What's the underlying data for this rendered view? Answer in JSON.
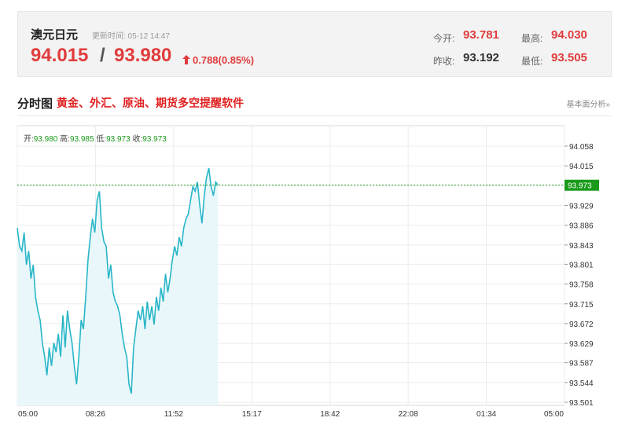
{
  "header": {
    "name": "澳元日元",
    "update_time": "更新时间: 05-12 14:47",
    "ask": "94.015",
    "slash": "/",
    "bid": "93.980",
    "change": "0.788(0.85%)",
    "stats": {
      "open_label": "今开:",
      "open": "93.781",
      "high_label": "最高:",
      "high": "94.030",
      "prev_label": "昨收:",
      "prev": "93.192",
      "low_label": "最低:",
      "low": "93.505"
    }
  },
  "section": {
    "title": "分时图",
    "promo": "黄金、外汇、原油、期货多空提醒软件",
    "fundamental_link": "基本面分析»"
  },
  "ohlc": {
    "open_label": "开:",
    "open": "93.980",
    "high_label": "高:",
    "high": "93.985",
    "low_label": "低:",
    "low": "93.973",
    "close_label": "收:",
    "close": "93.973"
  },
  "colors": {
    "up": "#e03c3c",
    "line": "#29b6c8",
    "area": "#e9f7fa",
    "current_badge": "#1a9a1a"
  },
  "chart_data": {
    "type": "area",
    "x_ticks": [
      "05:00",
      "08:26",
      "11:52",
      "15:17",
      "18:42",
      "22:08",
      "01:34",
      "05:00"
    ],
    "y_ticks": [
      94.058,
      94.015,
      93.973,
      93.929,
      93.886,
      93.843,
      93.801,
      93.758,
      93.715,
      93.672,
      93.629,
      93.587,
      93.544,
      93.501
    ],
    "ylim": [
      93.501,
      94.058
    ],
    "current_value": "93.973",
    "x_minutes_range": [
      0,
      1440
    ],
    "points": [
      [
        0,
        93.88
      ],
      [
        6,
        93.84
      ],
      [
        12,
        93.83
      ],
      [
        18,
        93.87
      ],
      [
        24,
        93.8
      ],
      [
        30,
        93.83
      ],
      [
        36,
        93.77
      ],
      [
        42,
        93.8
      ],
      [
        48,
        93.73
      ],
      [
        54,
        93.7
      ],
      [
        60,
        93.68
      ],
      [
        66,
        93.63
      ],
      [
        72,
        93.6
      ],
      [
        78,
        93.56
      ],
      [
        84,
        93.62
      ],
      [
        90,
        93.58
      ],
      [
        96,
        93.63
      ],
      [
        102,
        93.61
      ],
      [
        108,
        93.65
      ],
      [
        114,
        93.6
      ],
      [
        120,
        93.69
      ],
      [
        126,
        93.62
      ],
      [
        132,
        93.7
      ],
      [
        138,
        93.66
      ],
      [
        144,
        93.63
      ],
      [
        150,
        93.58
      ],
      [
        156,
        93.54
      ],
      [
        162,
        93.6
      ],
      [
        168,
        93.68
      ],
      [
        174,
        93.66
      ],
      [
        180,
        93.73
      ],
      [
        186,
        93.81
      ],
      [
        192,
        93.86
      ],
      [
        198,
        93.9
      ],
      [
        204,
        93.87
      ],
      [
        210,
        93.94
      ],
      [
        216,
        93.96
      ],
      [
        222,
        93.88
      ],
      [
        228,
        93.85
      ],
      [
        234,
        93.84
      ],
      [
        240,
        93.77
      ],
      [
        246,
        93.8
      ],
      [
        252,
        93.74
      ],
      [
        258,
        93.72
      ],
      [
        264,
        93.71
      ],
      [
        270,
        93.69
      ],
      [
        276,
        93.65
      ],
      [
        282,
        93.62
      ],
      [
        288,
        93.6
      ],
      [
        294,
        93.54
      ],
      [
        300,
        93.52
      ],
      [
        306,
        93.62
      ],
      [
        312,
        93.66
      ],
      [
        318,
        93.7
      ],
      [
        324,
        93.68
      ],
      [
        330,
        93.71
      ],
      [
        336,
        93.66
      ],
      [
        342,
        93.72
      ],
      [
        348,
        93.68
      ],
      [
        354,
        93.71
      ],
      [
        360,
        93.67
      ],
      [
        366,
        93.73
      ],
      [
        372,
        93.7
      ],
      [
        378,
        93.75
      ],
      [
        384,
        93.72
      ],
      [
        390,
        93.78
      ],
      [
        396,
        93.74
      ],
      [
        402,
        93.77
      ],
      [
        408,
        93.81
      ],
      [
        414,
        93.84
      ],
      [
        420,
        93.82
      ],
      [
        426,
        93.86
      ],
      [
        432,
        93.84
      ],
      [
        438,
        93.88
      ],
      [
        444,
        93.9
      ],
      [
        450,
        93.91
      ],
      [
        456,
        93.94
      ],
      [
        462,
        93.97
      ],
      [
        468,
        93.96
      ],
      [
        474,
        93.98
      ],
      [
        480,
        93.93
      ],
      [
        486,
        93.89
      ],
      [
        492,
        93.95
      ],
      [
        498,
        93.99
      ],
      [
        504,
        94.01
      ],
      [
        510,
        93.97
      ],
      [
        516,
        93.95
      ],
      [
        522,
        93.98
      ],
      [
        528,
        93.973
      ]
    ]
  }
}
